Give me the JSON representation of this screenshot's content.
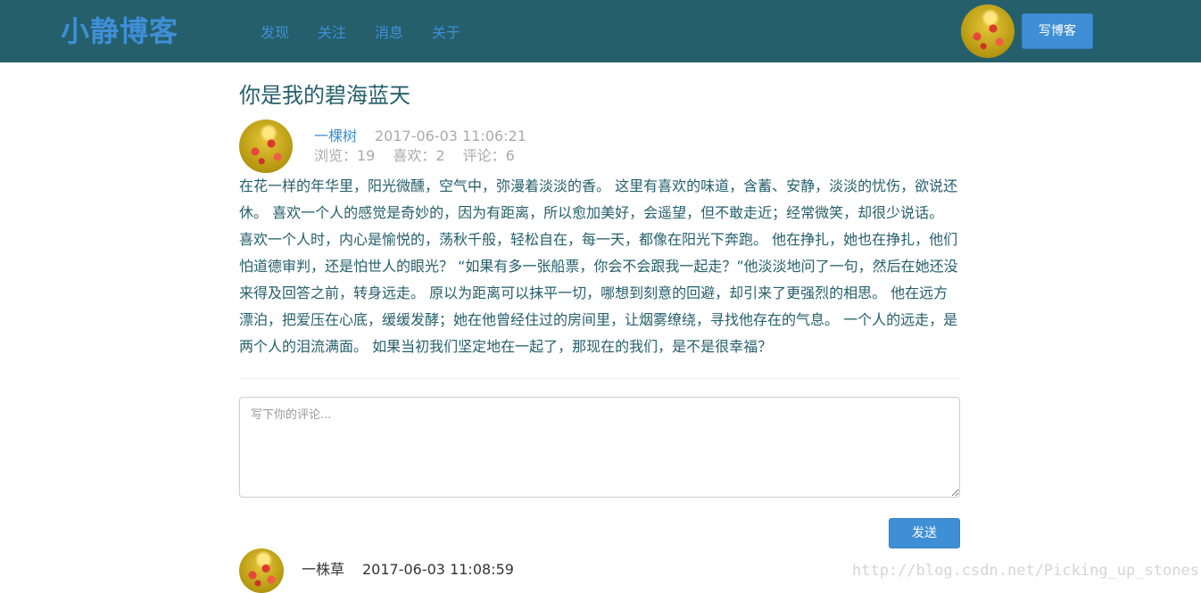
{
  "navbar": {
    "brand": "小静博客",
    "links": [
      "发现",
      "关注",
      "消息",
      "关于"
    ],
    "write_label": "写博客"
  },
  "post": {
    "title": "你是我的碧海蓝天",
    "author": "一棵树",
    "time": "2017-06-03 11:06:21",
    "stats": {
      "views": "浏览：19",
      "likes": "喜欢：2",
      "comments": "评论：6"
    },
    "body": "在花一样的年华里，阳光微醺，空气中，弥漫着淡淡的香。 这里有喜欢的味道，含蓄、安静，淡淡的忧伤，欲说还休。 喜欢一个人的感觉是奇妙的，因为有距离，所以愈加美好，会遥望，但不敢走近；经常微笑，却很少说话。 喜欢一个人时，内心是愉悦的，荡秋千般，轻松自在，每一天，都像在阳光下奔跑。 他在挣扎，她也在挣扎，他们怕道德审判，还是怕世人的眼光？ “如果有多一张船票，你会不会跟我一起走？”他淡淡地问了一句，然后在她还没来得及回答之前，转身远走。 原以为距离可以抹平一切，哪想到刻意的回避，却引来了更强烈的相思。 他在远方漂泊，把爱压在心底，缓缓发酵；她在他曾经住过的房间里，让烟雾缭绕，寻找他存在的气息。 一个人的远走，是两个人的泪流满面。 如果当初我们坚定地在一起了，那现在的我们，是不是很幸福？"
  },
  "comment_form": {
    "placeholder": "写下你的评论...",
    "send_label": "发送"
  },
  "comments": [
    {
      "author": "一株草",
      "time": "2017-06-03 11:08:59"
    }
  ],
  "watermark": "http://blog.csdn.net/Picking_up_stones"
}
